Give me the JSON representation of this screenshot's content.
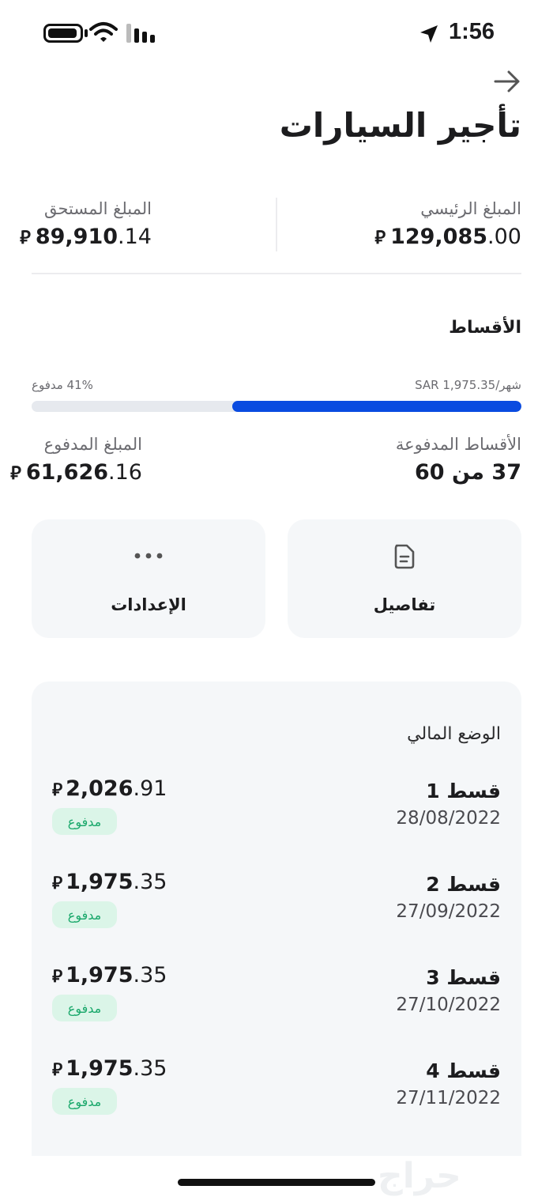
{
  "status_bar": {
    "time": "1:56",
    "battery_level": 0.8
  },
  "header": {
    "title": "تأجير السيارات"
  },
  "summary": {
    "principal": {
      "label": "المبلغ الرئيسي",
      "amount_int": "129,085",
      "amount_dec": ".00"
    },
    "due": {
      "label": "المبلغ المستحق",
      "amount_int": "89,910",
      "amount_dec": ".14"
    },
    "currency_symbol": "⃁"
  },
  "installments": {
    "title": "الأقساط",
    "monthly_label": "شهر/SAR 1,975.35",
    "paid_percent_label": "41% مدفوع",
    "progress": 0.41,
    "paid_installments": {
      "label": "الأقساط المدفوعة",
      "value": "37 من 60"
    },
    "paid_amount": {
      "label": "المبلغ المدفوع",
      "amount_int": "61,626",
      "amount_dec": ".16"
    }
  },
  "actions": {
    "details_label": "تفاصيل",
    "settings_label": "الإعدادات"
  },
  "finance": {
    "title": "الوضع المالي",
    "rows": [
      {
        "name": "قسط 1",
        "date": "28/08/2022",
        "amount_int": "2,026",
        "amount_dec": ".91",
        "status": "مدفوع"
      },
      {
        "name": "قسط 2",
        "date": "27/09/2022",
        "amount_int": "1,975",
        "amount_dec": ".35",
        "status": "مدفوع"
      },
      {
        "name": "قسط 3",
        "date": "27/10/2022",
        "amount_int": "1,975",
        "amount_dec": ".35",
        "status": "مدفوع"
      },
      {
        "name": "قسط 4",
        "date": "27/11/2022",
        "amount_int": "1,975",
        "amount_dec": ".35",
        "status": "مدفوع"
      }
    ]
  },
  "watermark": "حراج",
  "colors": {
    "accent": "#0a4be0",
    "paid_badge_bg": "#dbf5e8",
    "paid_badge_text": "#1aa86b",
    "card_bg": "#f5f7f9"
  }
}
